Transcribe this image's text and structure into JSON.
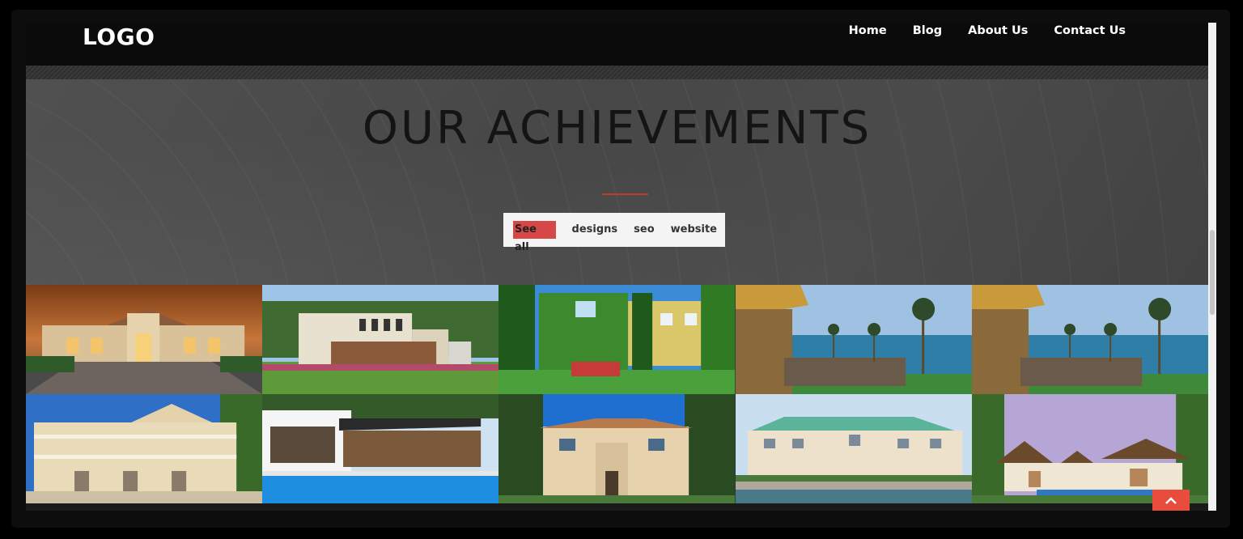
{
  "header": {
    "logo": "LOGO",
    "nav": [
      "Home",
      "Blog",
      "About Us",
      "Contact Us"
    ]
  },
  "hero": {
    "title": "OUR ACHIEVEMENTS",
    "accent_color": "#c0392b"
  },
  "filters": {
    "items": [
      "See all",
      "designs",
      "seo",
      "website"
    ],
    "active": "See all",
    "active_color": "#d64848"
  },
  "gallery": {
    "tiles": [
      {
        "name": "mansion-sunset"
      },
      {
        "name": "modern-cube-house"
      },
      {
        "name": "ivy-covered-villa"
      },
      {
        "name": "resort-ocean-palms"
      },
      {
        "name": "resort-ocean-palms-2"
      },
      {
        "name": "white-mediterranean-villa"
      },
      {
        "name": "modern-pool-house"
      },
      {
        "name": "beige-two-story-home"
      },
      {
        "name": "waterfront-green-roof-house"
      },
      {
        "name": "tropical-thatched-villa"
      }
    ]
  },
  "back_to_top": {
    "icon": "chevron-up-icon",
    "color": "#e74c3c"
  }
}
